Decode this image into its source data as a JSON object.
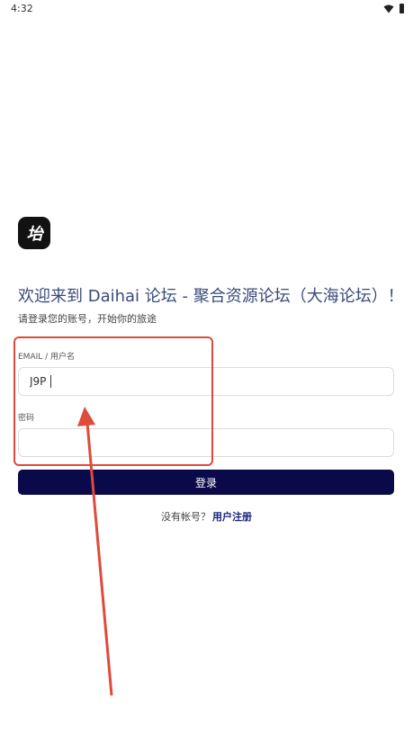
{
  "status_bar": {
    "time": "4:32",
    "wifi_icon": "wifi-icon",
    "battery_icon": "battery-icon"
  },
  "app": {
    "logo_text": "坮"
  },
  "welcome": {
    "title": "欢迎来到 Daihai 论坛 - 聚合资源论坛（大海论坛）！",
    "subtitle": "请登录您的账号，开始你的旅途"
  },
  "form": {
    "email_label": "EMAIL / 用户名",
    "email_value": "J9P",
    "password_label": "密码",
    "password_value": "",
    "login_button": "登录"
  },
  "register": {
    "prompt": "没有帐号？",
    "link": "用户注册"
  },
  "colors": {
    "accent": "#0a0a4a",
    "title": "#3a4a7a",
    "link": "#1a237e",
    "annotation": "#e04a3b"
  }
}
